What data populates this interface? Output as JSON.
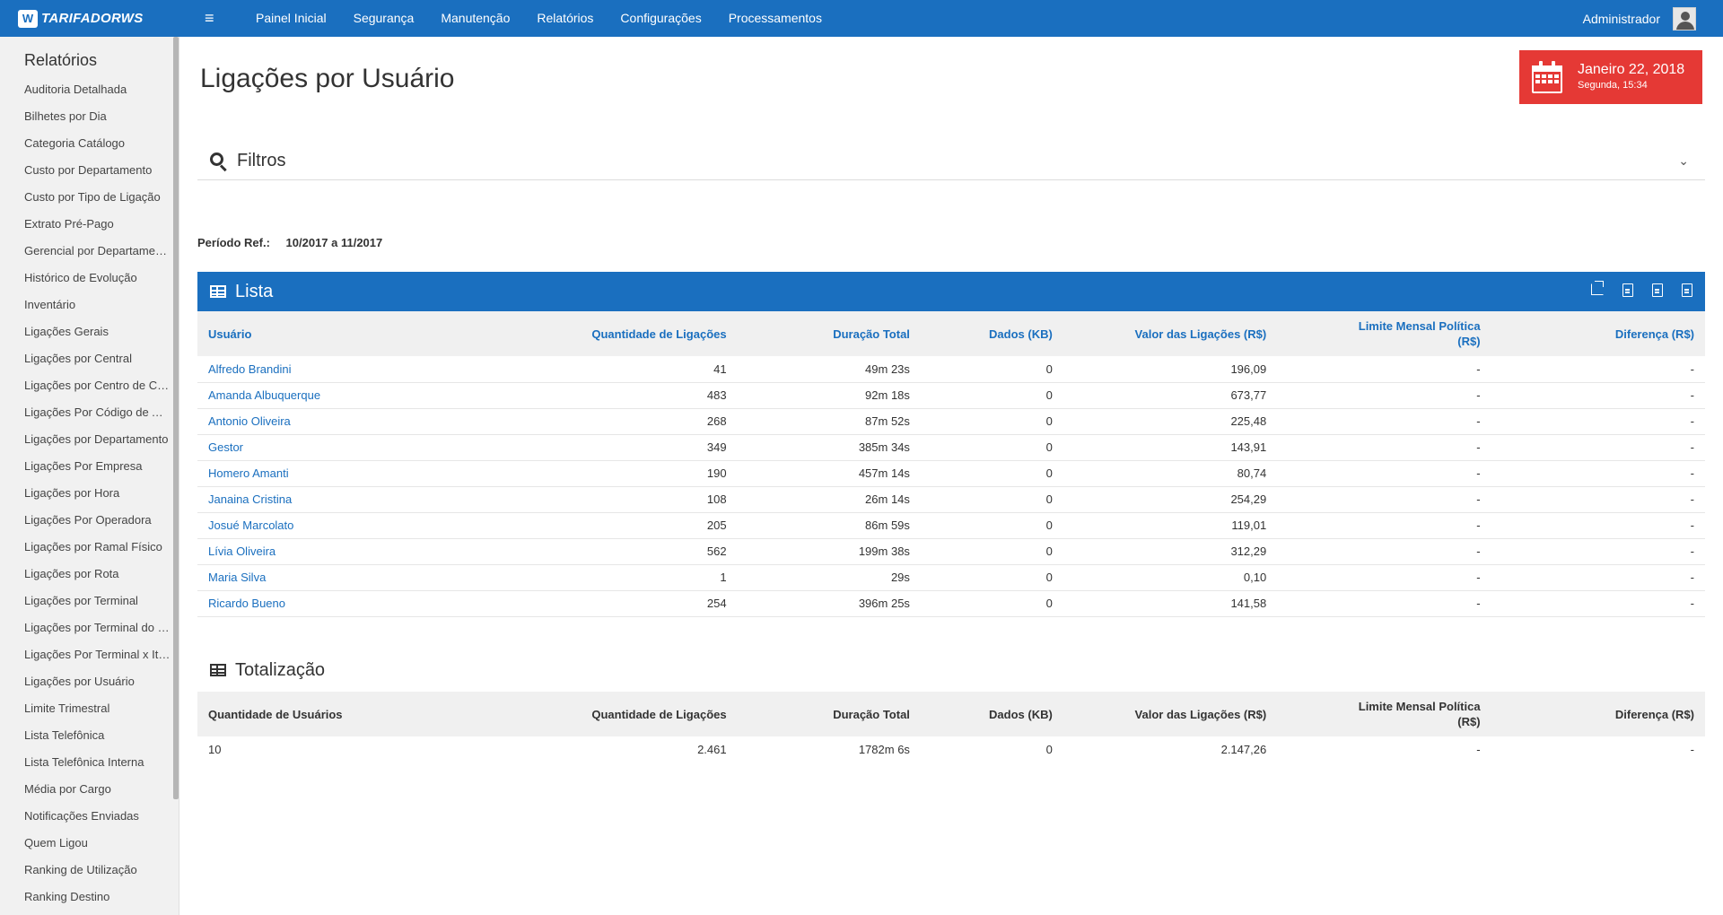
{
  "app": {
    "logo_mark": "W",
    "logo_text": "TARIFADORWS",
    "menu_glyph": "≡"
  },
  "nav": [
    "Painel Inicial",
    "Segurança",
    "Manutenção",
    "Relatórios",
    "Configurações",
    "Processamentos"
  ],
  "user": {
    "name": "Administrador",
    "icon": "user-avatar-icon"
  },
  "sidebar": {
    "title": "Relatórios",
    "items": [
      "Auditoria Detalhada",
      "Bilhetes por Dia",
      "Categoria Catálogo",
      "Custo por Departamento",
      "Custo por Tipo de Ligação",
      "Extrato Pré-Pago",
      "Gerencial por Departamento",
      "Histórico de Evolução",
      "Inventário",
      "Ligações Gerais",
      "Ligações por Central",
      "Ligações por Centro de Custo",
      "Ligações Por Código de Acesso",
      "Ligações por Departamento",
      "Ligações Por Empresa",
      "Ligações por Hora",
      "Ligações Por Operadora",
      "Ligações por Ramal Físico",
      "Ligações por Rota",
      "Ligações por Terminal",
      "Ligações por Terminal do Usuário",
      "Ligações Por Terminal x Item",
      "Ligações por Usuário",
      "Limite Trimestral",
      "Lista Telefônica",
      "Lista Telefônica Interna",
      "Média por Cargo",
      "Notificações Enviadas",
      "Quem Ligou",
      "Ranking de Utilização",
      "Ranking Destino"
    ]
  },
  "page": {
    "title": "Ligações por Usuário"
  },
  "date_box": {
    "main": "Janeiro 22, 2018",
    "sub": "Segunda, 15:34",
    "color": "#e53935"
  },
  "filters": {
    "title": "Filtros",
    "chevron": "⌄"
  },
  "period": {
    "label": "Período Ref.:",
    "value": "10/2017 a 11/2017"
  },
  "lista": {
    "title": "Lista",
    "columns": [
      "Usuário",
      "Quantidade de Ligações",
      "Duração Total",
      "Dados (KB)",
      "Valor das Ligações (R$)",
      "Limite Mensal Política (R$)",
      "Diferença (R$)"
    ],
    "rows": [
      [
        "Alfredo Brandini",
        "41",
        "49m 23s",
        "0",
        "196,09",
        "-",
        "-"
      ],
      [
        "Amanda Albuquerque",
        "483",
        "92m 18s",
        "0",
        "673,77",
        "-",
        "-"
      ],
      [
        "Antonio Oliveira",
        "268",
        "87m 52s",
        "0",
        "225,48",
        "-",
        "-"
      ],
      [
        "Gestor",
        "349",
        "385m 34s",
        "0",
        "143,91",
        "-",
        "-"
      ],
      [
        "Homero Amanti",
        "190",
        "457m 14s",
        "0",
        "80,74",
        "-",
        "-"
      ],
      [
        "Janaina Cristina",
        "108",
        "26m 14s",
        "0",
        "254,29",
        "-",
        "-"
      ],
      [
        "Josué Marcolato",
        "205",
        "86m 59s",
        "0",
        "119,01",
        "-",
        "-"
      ],
      [
        "Lívia Oliveira",
        "562",
        "199m 38s",
        "0",
        "312,29",
        "-",
        "-"
      ],
      [
        "Maria Silva",
        "1",
        "29s",
        "0",
        "0,10",
        "-",
        "-"
      ],
      [
        "Ricardo Bueno",
        "254",
        "396m 25s",
        "0",
        "141,58",
        "-",
        "-"
      ]
    ]
  },
  "totalizacao": {
    "title": "Totalização",
    "columns": [
      "Quantidade de Usuários",
      "Quantidade de Ligações",
      "Duração Total",
      "Dados (KB)",
      "Valor das Ligações (R$)",
      "Limite Mensal Política (R$)",
      "Diferença (R$)"
    ],
    "row": [
      "10",
      "2.461",
      "1782m 6s",
      "0",
      "2.147,26",
      "-",
      "-"
    ]
  },
  "colors": {
    "brand": "#1a6fbf",
    "date_accent": "#e53935"
  }
}
